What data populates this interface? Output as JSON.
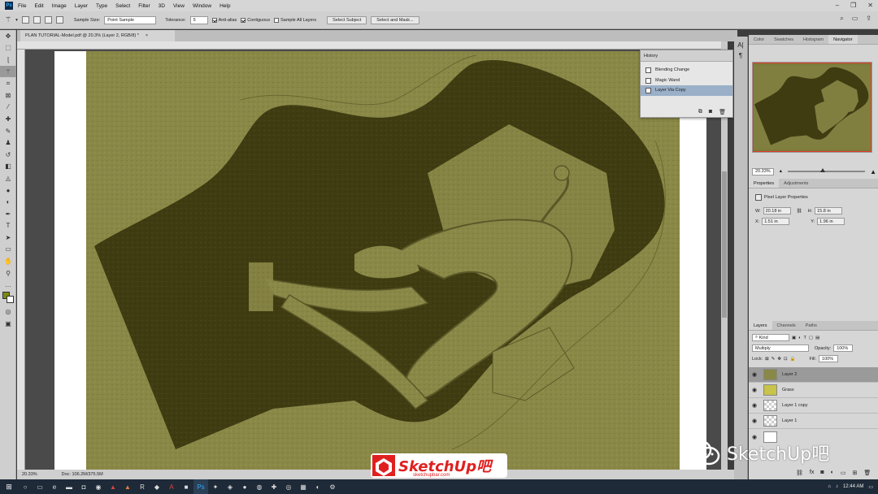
{
  "menu": {
    "app_icon": "Ps",
    "items": [
      "File",
      "Edit",
      "Image",
      "Layer",
      "Type",
      "Select",
      "Filter",
      "3D",
      "View",
      "Window",
      "Help"
    ]
  },
  "options": {
    "sample_size_label": "Sample Size:",
    "sample_size_value": "Point Sample",
    "tolerance_label": "Tolerance:",
    "tolerance_value": "5",
    "anti_alias": "Anti-alias",
    "contiguous": "Contiguous",
    "sample_all_layers": "Sample All Layers",
    "select_subject": "Select Subject",
    "select_and_mask": "Select and Mask..."
  },
  "document": {
    "tab_title": "PLAN TUTORIAL-Model.pdf @ 20.3% (Layer 2, RGB/8) *",
    "status_zoom": "20.33%",
    "status_doc": "Doc: 106.2M/375.5M"
  },
  "history": {
    "title": "History",
    "items": [
      "Blending Change",
      "Magic Wand",
      "Layer Via Copy"
    ],
    "selected_index": 2
  },
  "navigator": {
    "tabs": [
      "Color",
      "Swatches",
      "Histogram",
      "Navigator"
    ],
    "active_tab": "Navigator",
    "zoom": "20.33%"
  },
  "properties": {
    "tabs": [
      "Properties",
      "Adjustments"
    ],
    "section": "Pixel Layer Properties",
    "w_label": "W:",
    "w_value": "20.18 in",
    "h_label": "H:",
    "h_value": "15.8 in",
    "x_label": "X:",
    "x_value": "1.51 in",
    "y_label": "Y:",
    "y_value": "1.96 in"
  },
  "layers": {
    "tabs": [
      "Layers",
      "Channels",
      "Paths"
    ],
    "filter": "Kind",
    "blend_mode": "Multiply",
    "opacity_label": "Opacity:",
    "opacity": "100%",
    "lock_label": "Lock:",
    "fill_label": "Fill:",
    "fill": "100%",
    "items": [
      "Layer 2",
      "Grass",
      "Layer 1 copy",
      "Layer 1"
    ],
    "selected_index": 0
  },
  "watermark": {
    "logo_text": "SketchUp吧",
    "logo_url": "sketchupbar.com",
    "text": "SketchUp吧"
  },
  "taskbar": {
    "time": "12:44 AM"
  },
  "colors": {
    "map_light": "#8a8847",
    "map_dark": "#3f3c12",
    "accent_red": "#e23a2a"
  }
}
